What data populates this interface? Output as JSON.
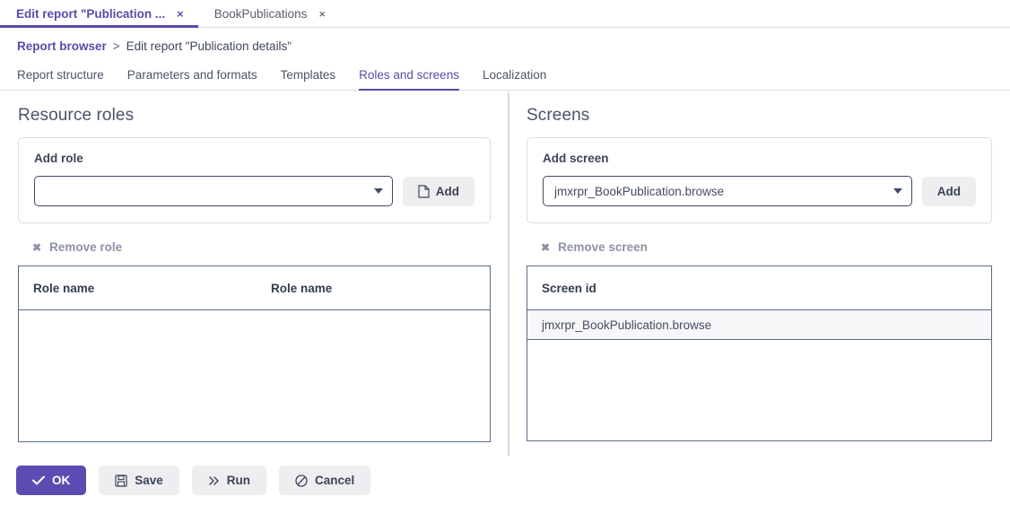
{
  "accent": "#5a4bab",
  "primary_button": "#5c4bb0",
  "window_tabs": [
    {
      "label": "Edit report \"Publication ...",
      "close": "×",
      "active": true
    },
    {
      "label": "BookPublications",
      "close": "×",
      "active": false
    }
  ],
  "breadcrumb": {
    "link": "Report browser",
    "separator": ">",
    "current": "Edit report \"Publication details\""
  },
  "section_tabs": [
    {
      "label": "Report structure",
      "active": false
    },
    {
      "label": "Parameters and formats",
      "active": false
    },
    {
      "label": "Templates",
      "active": false
    },
    {
      "label": "Roles and screens",
      "active": true
    },
    {
      "label": "Localization",
      "active": false
    }
  ],
  "resource_roles": {
    "title": "Resource roles",
    "add_card": {
      "label": "Add role",
      "select_value": "",
      "select_placeholder": "",
      "add_button": "Add",
      "add_button_icon": "file-icon"
    },
    "remove_link": {
      "label": "Remove role",
      "icon": "close-x-icon"
    },
    "table": {
      "columns": [
        "Role name",
        "Role name"
      ],
      "rows": []
    }
  },
  "screens": {
    "title": "Screens",
    "add_card": {
      "label": "Add screen",
      "select_value": "jmxrpr_BookPublication.browse",
      "add_button": "Add"
    },
    "remove_link": {
      "label": "Remove screen",
      "icon": "close-x-icon"
    },
    "table": {
      "columns": [
        "Screen id"
      ],
      "rows": [
        [
          "jmxrpr_BookPublication.browse"
        ]
      ]
    }
  },
  "footer": {
    "buttons": [
      {
        "label": "OK",
        "icon": "check-icon",
        "style": "primary"
      },
      {
        "label": "Save",
        "icon": "floppy-disk-icon",
        "style": "plain"
      },
      {
        "label": "Run",
        "icon": "double-chevron-right-icon",
        "style": "plain"
      },
      {
        "label": "Cancel",
        "icon": "circle-slash-icon",
        "style": "plain"
      }
    ]
  }
}
